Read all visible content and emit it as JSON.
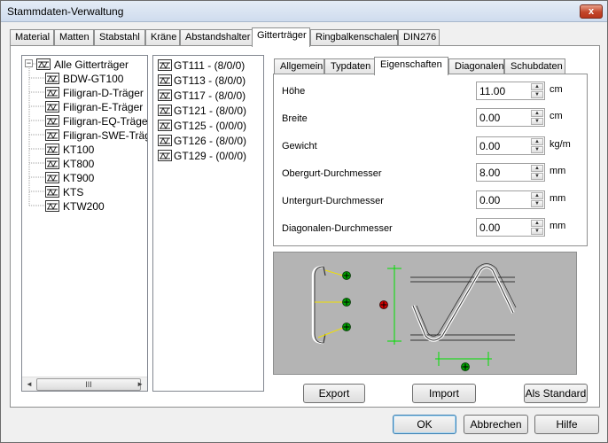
{
  "window": {
    "title": "Stammdaten-Verwaltung",
    "close_glyph": "x"
  },
  "tabs": [
    "Material",
    "Matten",
    "Stabstahl",
    "Kräne",
    "Abstandshalter",
    "Gitterträger",
    "Ringbalkenschalen",
    "DIN276"
  ],
  "active_tab": "Gitterträger",
  "tree": {
    "root": "Alle Gitterträger",
    "expander": "−",
    "items": [
      "BDW-GT100",
      "Filigran-D-Träger",
      "Filigran-E-Träger",
      "Filigran-EQ-Träger",
      "Filigran-SWE-Träger",
      "KT100",
      "KT800",
      "KT900",
      "KTS",
      "KTW200"
    ],
    "scroll_thumb": "III",
    "scroll_left": "◄",
    "scroll_right": "►"
  },
  "list": {
    "items": [
      "GT111 - (8/0/0)",
      "GT113 - (8/0/0)",
      "GT117 - (8/0/0)",
      "GT121 - (8/0/0)",
      "GT125 - (0/0/0)",
      "GT126 - (8/0/0)",
      "GT129 - (0/0/0)"
    ]
  },
  "subtabs": [
    "Allgemein",
    "Typdaten",
    "Eigenschaften",
    "Diagonalen",
    "Schubdaten"
  ],
  "active_subtab": "Eigenschaften",
  "properties": [
    {
      "label": "Höhe",
      "value": "11.00",
      "unit": "cm"
    },
    {
      "label": "Breite",
      "value": "0.00",
      "unit": "cm"
    },
    {
      "label": "Gewicht",
      "value": "0.00",
      "unit": "kg/m"
    },
    {
      "label": "Obergurt-Durchmesser",
      "value": "8.00",
      "unit": "mm"
    },
    {
      "label": "Untergurt-Durchmesser",
      "value": "0.00",
      "unit": "mm"
    },
    {
      "label": "Diagonalen-Durchmesser",
      "value": "0.00",
      "unit": "mm"
    }
  ],
  "spin_up": "▲",
  "spin_down": "▼",
  "panel_buttons": {
    "export": "Export",
    "import": "Import",
    "standard": "Als Standard"
  },
  "dialog_buttons": {
    "ok": "OK",
    "cancel": "Abbrechen",
    "help": "Hilfe"
  },
  "colors": {
    "accent_green": "#00c800",
    "marker_red": "#d40000",
    "preview_bg": "#b4b4b4",
    "title_bar": "#cfdcee"
  }
}
